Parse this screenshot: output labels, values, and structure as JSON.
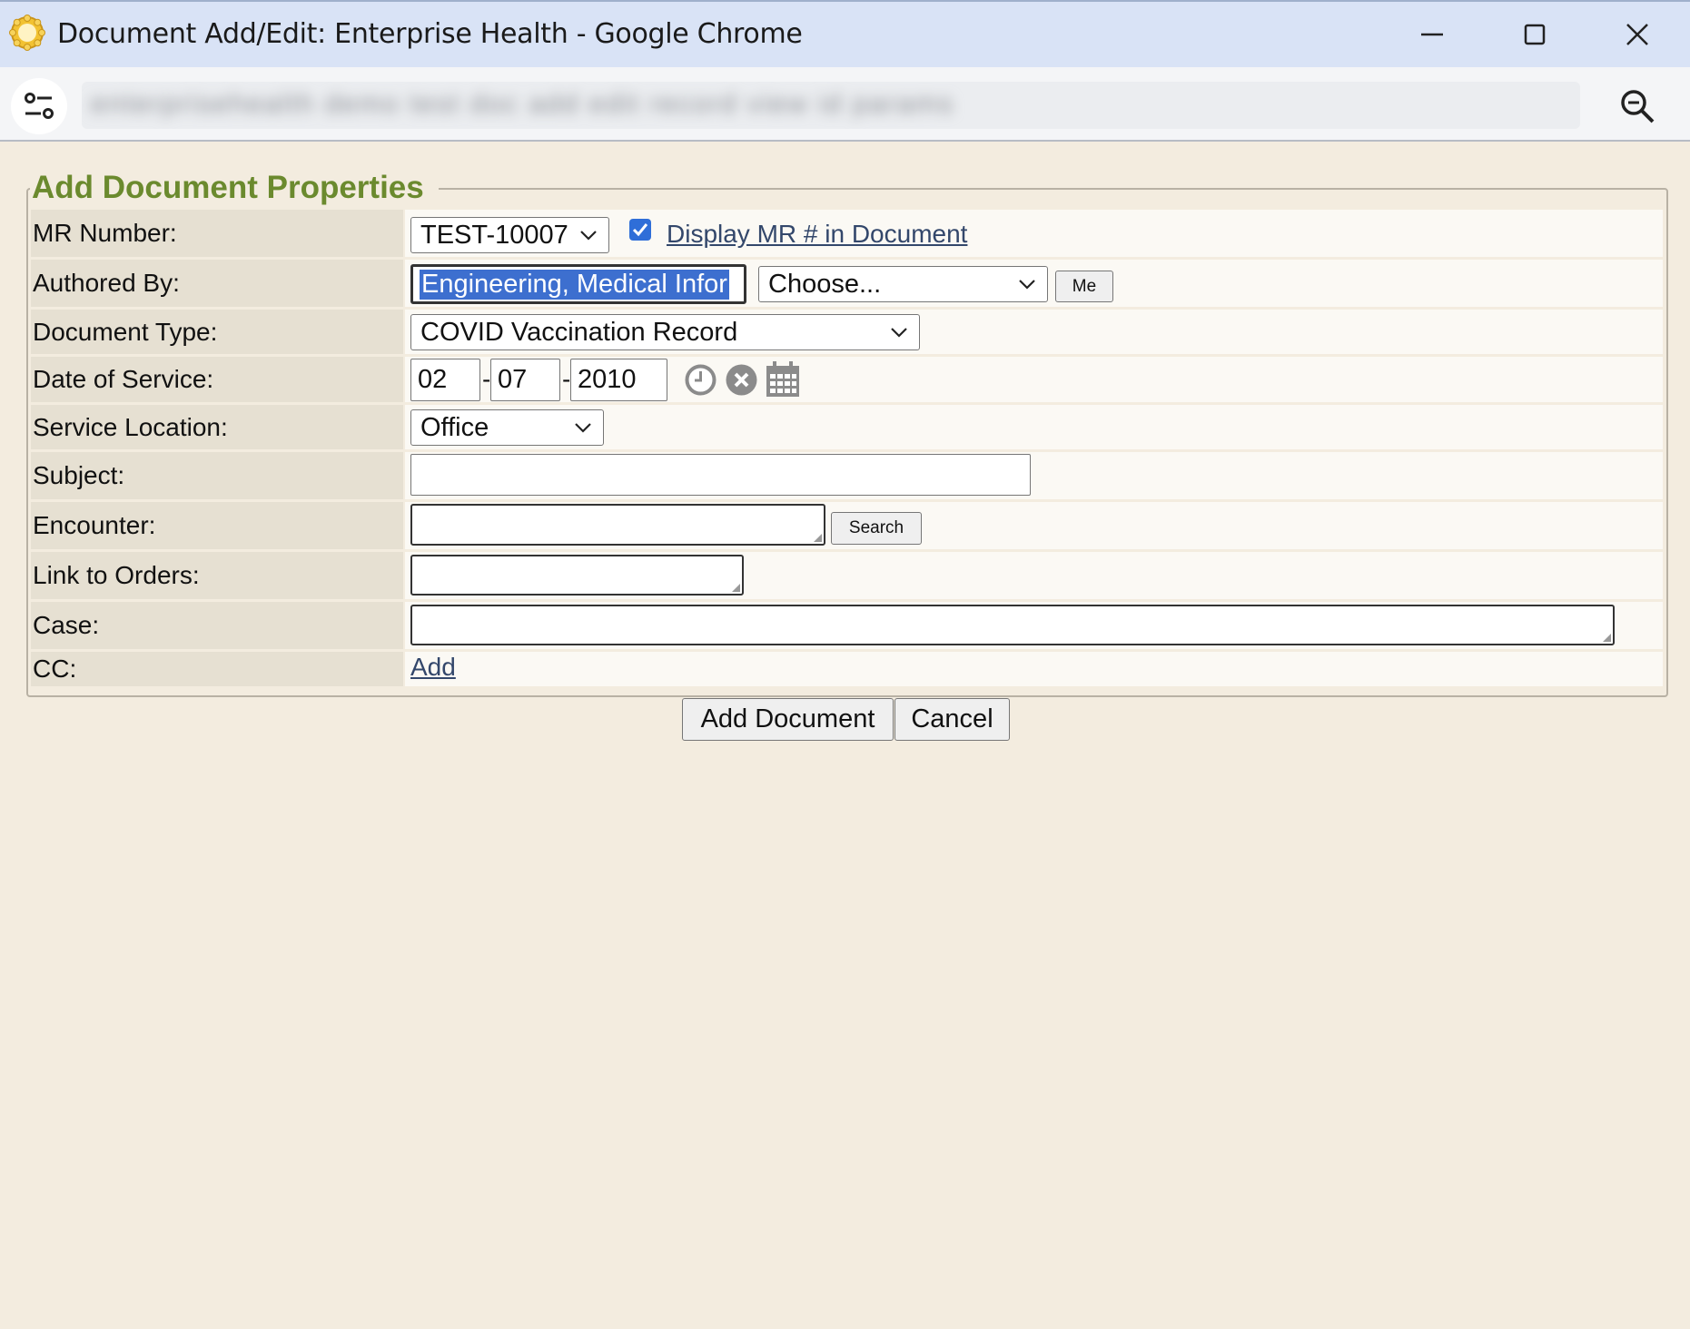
{
  "window": {
    "title": "Document Add/Edit: Enterprise Health - Google Chrome",
    "url_blurred": "enterprisehealth demo test doc add edit record view id params"
  },
  "form": {
    "legend": "Add Document Properties",
    "mr_number": {
      "label": "MR Number:",
      "value": "TEST-10007",
      "display_checkbox_checked": true,
      "display_link": "Display MR # in Document"
    },
    "authored_by": {
      "label": "Authored By:",
      "input_value": "Engineering, Medical Infor",
      "choose_value": "Choose...",
      "me_button": "Me"
    },
    "document_type": {
      "label": "Document Type:",
      "value": "COVID Vaccination Record"
    },
    "date_of_service": {
      "label": "Date of Service:",
      "month": "02",
      "day": "07",
      "year": "2010",
      "sep": "-"
    },
    "service_location": {
      "label": "Service Location:",
      "value": "Office"
    },
    "subject": {
      "label": "Subject:",
      "value": ""
    },
    "encounter": {
      "label": "Encounter:",
      "value": "",
      "search_button": "Search"
    },
    "link_to_orders": {
      "label": "Link to Orders:",
      "value": ""
    },
    "case": {
      "label": "Case:",
      "value": ""
    },
    "cc": {
      "label": "CC:",
      "add_link": "Add"
    }
  },
  "actions": {
    "add_document": "Add Document",
    "cancel": "Cancel"
  },
  "colors": {
    "legend": "#6b8a2e",
    "page_bg": "#f3ecdf",
    "label_bg": "#e6e0d2",
    "selection": "#3d6fcf"
  }
}
